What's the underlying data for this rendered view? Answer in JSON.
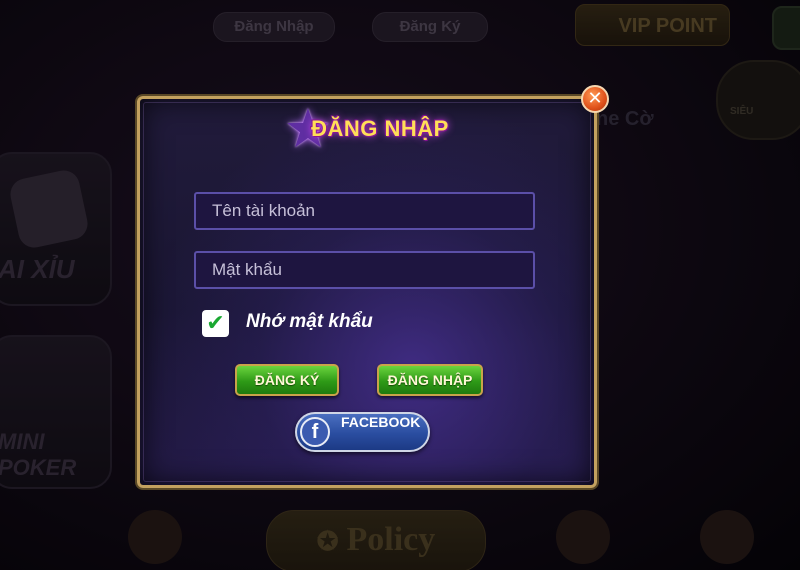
{
  "background": {
    "top_tabs": {
      "login": "Đăng Nhập",
      "register": "Đăng Ký"
    },
    "vip_label": "VIP POINT",
    "side_text": "ne Cờ",
    "badge_text": "SIÊU",
    "games": {
      "taixiu": "AI XỈU",
      "poker": "MINI POKER"
    },
    "policy_label": "Policy"
  },
  "modal": {
    "title": "ĐĂNG NHẬP",
    "username_placeholder": "Tên tài khoản",
    "password_placeholder": "Mật khẩu",
    "remember_label": "Nhớ mật khẩu",
    "remember_checked": true,
    "register_button": "ĐĂNG KÝ",
    "login_button": "ĐĂNG NHẬP",
    "facebook_button": "FACEBOOK",
    "close_symbol": "✕"
  },
  "colors": {
    "accent_gold": "#c3a15f",
    "title_yellow": "#ffdf57",
    "button_green": "#2e9a17",
    "facebook_blue": "#2a4da0",
    "close_orange": "#e0511a"
  }
}
